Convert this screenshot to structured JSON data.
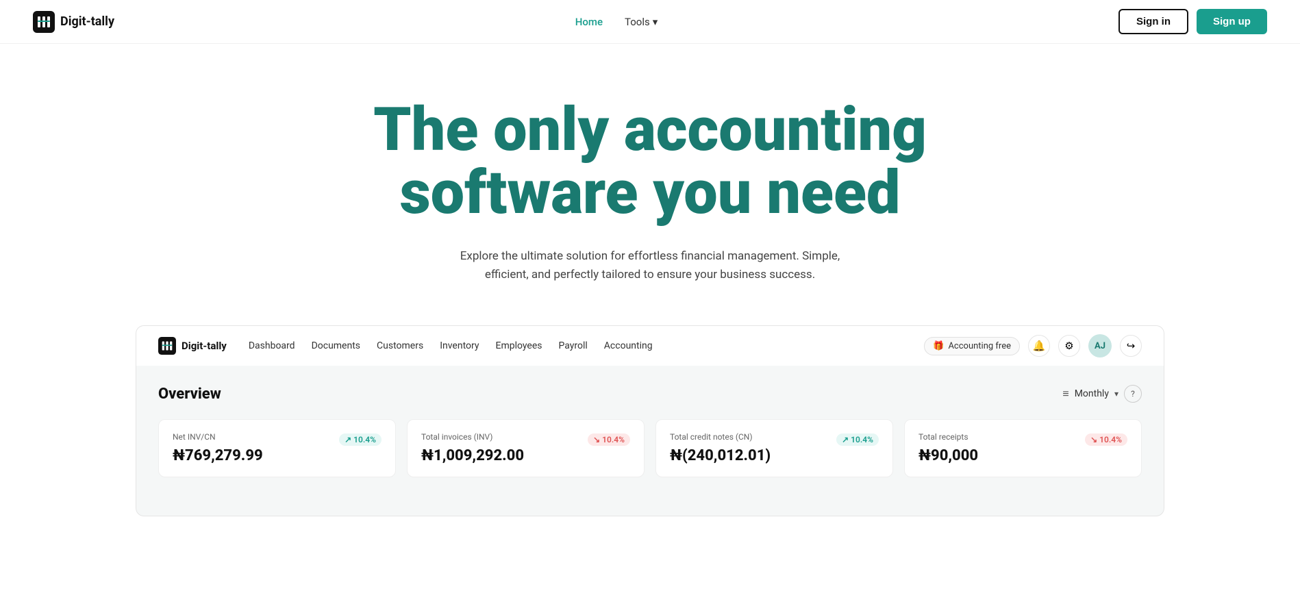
{
  "topNav": {
    "logoText": "Digit-tally",
    "links": [
      {
        "label": "Home",
        "active": true
      },
      {
        "label": "Tools",
        "hasDropdown": true
      }
    ],
    "signinLabel": "Sign in",
    "signupLabel": "Sign up"
  },
  "hero": {
    "title": "The only accounting software you need",
    "subtitle": "Explore the ultimate solution for effortless financial management. Simple, efficient, and perfectly tailored to ensure your business success."
  },
  "appNav": {
    "logoText": "Digit-tally",
    "links": [
      {
        "label": "Dashboard"
      },
      {
        "label": "Documents"
      },
      {
        "label": "Customers"
      },
      {
        "label": "Inventory"
      },
      {
        "label": "Employees"
      },
      {
        "label": "Payroll"
      },
      {
        "label": "Accounting"
      }
    ],
    "badgeLabel": "Accounting free",
    "avatarInitials": "AJ"
  },
  "dashboard": {
    "overviewTitle": "Overview",
    "filterLabel": "Monthly",
    "stats": [
      {
        "label": "Net INV/CN",
        "value": "₦769,279.99",
        "badgeValue": "10.4%",
        "badgeUp": true
      },
      {
        "label": "Total invoices (INV)",
        "value": "₦1,009,292.00",
        "badgeValue": "10.4%",
        "badgeUp": false
      },
      {
        "label": "Total credit notes (CN)",
        "value": "₦(240,012.01)",
        "badgeValue": "10.4%",
        "badgeUp": true
      },
      {
        "label": "Total receipts",
        "value": "₦90,000",
        "badgeValue": "10.4%",
        "badgeUp": false
      }
    ]
  },
  "icons": {
    "chevronDown": "▾",
    "filter": "≡",
    "questionMark": "?",
    "bell": "🔔",
    "settings": "⚙",
    "logout": "↪",
    "arrowUp": "↗",
    "arrowDown": "↘",
    "gift": "🎁"
  }
}
